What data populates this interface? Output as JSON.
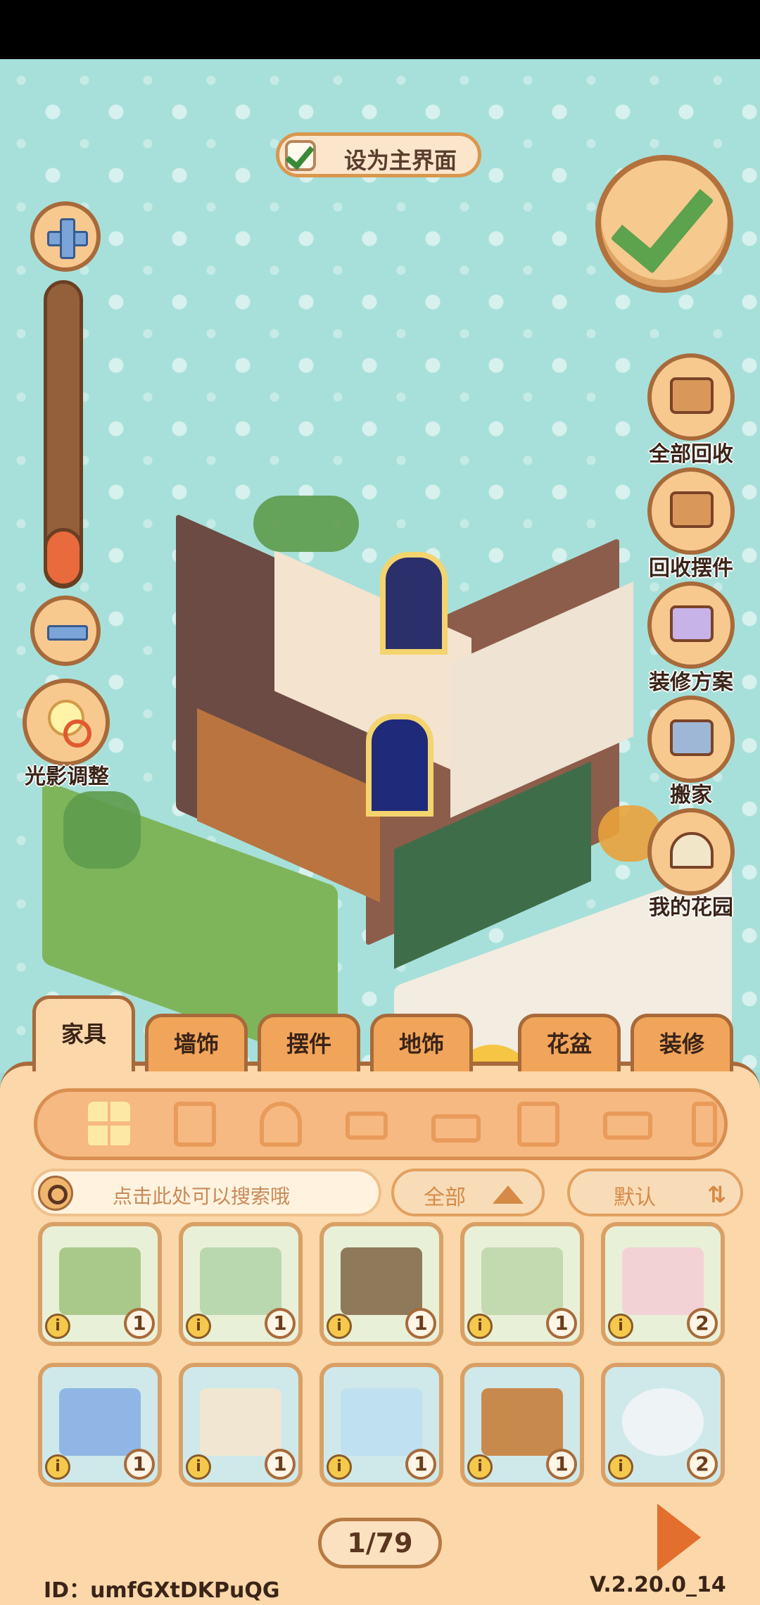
{
  "top": {
    "set_home_label": "设为主界面"
  },
  "left": {
    "light_label": "光影调整",
    "zoom_level": 0.1
  },
  "right_tools": [
    {
      "label": "全部回收",
      "icon": "box-recycle-icon"
    },
    {
      "label": "回收摆件",
      "icon": "box-cups-icon"
    },
    {
      "label": "装修方案",
      "icon": "plan-cards-icon"
    },
    {
      "label": "搬家",
      "icon": "moving-truck-icon"
    },
    {
      "label": "我的花园",
      "icon": "garden-arch-icon"
    }
  ],
  "tabs": [
    "家具",
    "墙饰",
    "摆件",
    "地饰",
    "花盆",
    "装修"
  ],
  "search": {
    "placeholder": "点击此处可以搜索哦"
  },
  "filter": {
    "label": "全部"
  },
  "sort": {
    "label": "默认",
    "icon": "sort-icon"
  },
  "items": [
    {
      "count": "1",
      "info": "i"
    },
    {
      "count": "1",
      "info": "i"
    },
    {
      "count": "1",
      "info": "i"
    },
    {
      "count": "1",
      "info": "i"
    },
    {
      "count": "2",
      "info": "i"
    },
    {
      "count": "1",
      "info": "i"
    },
    {
      "count": "1",
      "info": "i"
    },
    {
      "count": "1",
      "info": "i"
    },
    {
      "count": "1",
      "info": "i"
    },
    {
      "count": "2",
      "info": "i"
    }
  ],
  "pagination": {
    "text": "1/79"
  },
  "footer": {
    "id": "ID：umfGXtDKPuQG",
    "version": "V.2.20.0_14"
  },
  "colors": {
    "panel": "#fbd7a9",
    "border": "#a86a3a",
    "accent": "#e26f2d",
    "check": "#5da24c"
  }
}
